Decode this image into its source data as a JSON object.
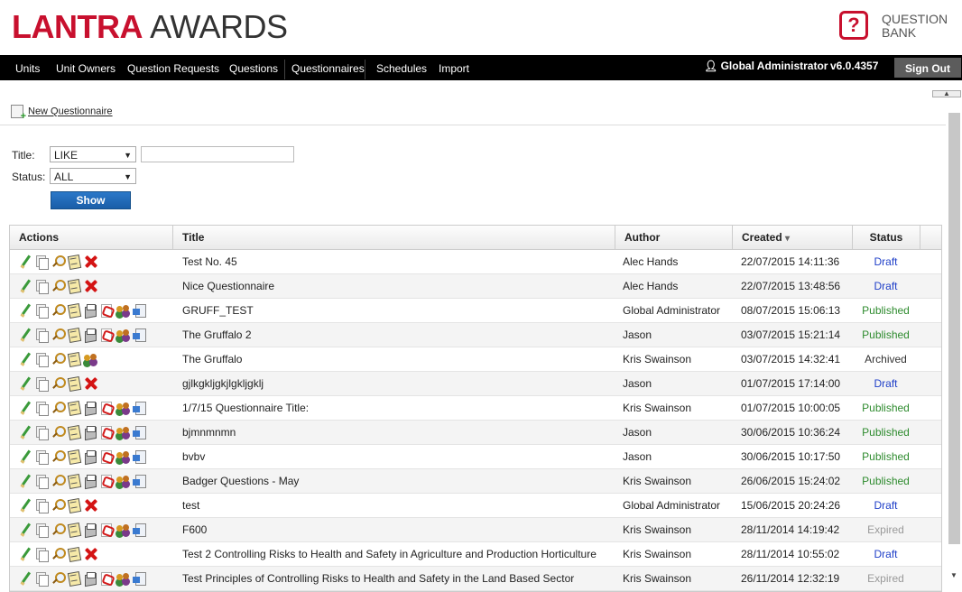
{
  "header": {
    "logo_lantra": "LANTRA",
    "logo_awards": "AWARDS",
    "qb_symbol": "?",
    "qb_line1": "QUESTION",
    "qb_line2": "BANK"
  },
  "nav": {
    "items": [
      "Units",
      "Unit Owners",
      "Question Requests",
      "Questions",
      "Questionnaires",
      "Schedules",
      "Import"
    ],
    "user": "Global Administrator",
    "version": "v6.0.4357",
    "signout": "Sign Out"
  },
  "toolbar": {
    "new_questionnaire": "New Questionnaire"
  },
  "filters": {
    "title_label": "Title:",
    "title_operator": "LIKE",
    "title_value": "",
    "status_label": "Status:",
    "status_value": "ALL",
    "show_button": "Show"
  },
  "table": {
    "columns": [
      "Actions",
      "Title",
      "Author",
      "Created",
      "Status"
    ],
    "sort_indicator": "▾",
    "rows": [
      {
        "actions": [
          "edit",
          "copy",
          "view",
          "notes",
          "delete"
        ],
        "title": "Test No. 45",
        "author": "Alec Hands",
        "created": "22/07/2015 14:11:36",
        "status": "Draft"
      },
      {
        "actions": [
          "edit",
          "copy",
          "view",
          "notes",
          "delete"
        ],
        "title": "Nice Questionnaire",
        "author": "Alec Hands",
        "created": "22/07/2015 13:48:56",
        "status": "Draft"
      },
      {
        "actions": [
          "edit",
          "copy",
          "view",
          "notes",
          "print",
          "pdf",
          "users",
          "export"
        ],
        "title": "GRUFF_TEST",
        "author": "Global Administrator",
        "created": "08/07/2015 15:06:13",
        "status": "Published"
      },
      {
        "actions": [
          "edit",
          "copy",
          "view",
          "notes",
          "print",
          "pdf",
          "users",
          "export"
        ],
        "title": "The Gruffalo 2",
        "author": "Jason",
        "created": "03/07/2015 15:21:14",
        "status": "Published"
      },
      {
        "actions": [
          "edit",
          "copy",
          "view",
          "notes",
          "users"
        ],
        "title": "The Gruffalo",
        "author": "Kris Swainson",
        "created": "03/07/2015 14:32:41",
        "status": "Archived"
      },
      {
        "actions": [
          "edit",
          "copy",
          "view",
          "notes",
          "delete"
        ],
        "title": "gjlkgkljgkjlgkljgklj",
        "author": "Jason",
        "created": "01/07/2015 17:14:00",
        "status": "Draft"
      },
      {
        "actions": [
          "edit",
          "copy",
          "view",
          "notes",
          "print",
          "pdf",
          "users",
          "export"
        ],
        "title": "1/7/15 Questionnaire Title:",
        "author": "Kris Swainson",
        "created": "01/07/2015 10:00:05",
        "status": "Published"
      },
      {
        "actions": [
          "edit",
          "copy",
          "view",
          "notes",
          "print",
          "pdf",
          "users",
          "export"
        ],
        "title": "bjmnmnmn",
        "author": "Jason",
        "created": "30/06/2015 10:36:24",
        "status": "Published"
      },
      {
        "actions": [
          "edit",
          "copy",
          "view",
          "notes",
          "print",
          "pdf",
          "users",
          "export"
        ],
        "title": "bvbv",
        "author": "Jason",
        "created": "30/06/2015 10:17:50",
        "status": "Published"
      },
      {
        "actions": [
          "edit",
          "copy",
          "view",
          "notes",
          "print",
          "pdf",
          "users",
          "export"
        ],
        "title": "Badger Questions - May",
        "author": "Kris Swainson",
        "created": "26/06/2015 15:24:02",
        "status": "Published"
      },
      {
        "actions": [
          "edit",
          "copy",
          "view",
          "notes",
          "delete"
        ],
        "title": "test",
        "author": "Global Administrator",
        "created": "15/06/2015 20:24:26",
        "status": "Draft"
      },
      {
        "actions": [
          "edit",
          "copy",
          "view",
          "notes",
          "print",
          "pdf",
          "users",
          "export"
        ],
        "title": "F600",
        "author": "Kris Swainson",
        "created": "28/11/2014 14:19:42",
        "status": "Expired"
      },
      {
        "actions": [
          "edit",
          "copy",
          "view",
          "notes",
          "delete"
        ],
        "title": "Test 2 Controlling Risks to Health and Safety in Agriculture and Production Horticulture",
        "author": "Kris Swainson",
        "created": "28/11/2014 10:55:02",
        "status": "Draft"
      },
      {
        "actions": [
          "edit",
          "copy",
          "view",
          "notes",
          "print",
          "pdf",
          "users",
          "export"
        ],
        "title": "Test Principles of Controlling Risks to Health and Safety in the Land Based Sector",
        "author": "Kris Swainson",
        "created": "26/11/2014 12:32:19",
        "status": "Expired"
      }
    ]
  }
}
